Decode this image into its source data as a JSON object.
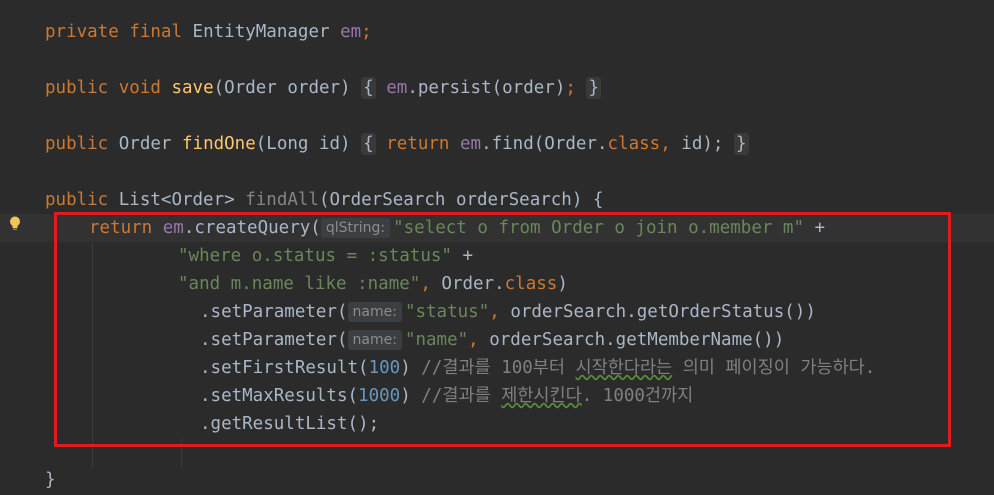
{
  "code": {
    "l1": {
      "kw1": "private",
      "kw2": "final",
      "type": "EntityManager",
      "field": "em",
      "end": ";"
    },
    "l2": {
      "kw1": "public",
      "kw2": "void",
      "name": "save",
      "params": "(Order order)",
      "brace_open": "{",
      "field": "em",
      "call": ".persist(order)",
      "semi": ";",
      "brace_close": "}"
    },
    "l3": {
      "kw1": "public",
      "type": "Order",
      "name": "findOne",
      "params": "(Long id)",
      "brace_open": "{",
      "ret": "return",
      "field": "em",
      "call1": ".find(Order.",
      "kw_class": "class",
      "comma": ",",
      "call2": " id);",
      "brace_close": "}"
    },
    "l4": {
      "kw1": "public",
      "type": "List<Order>",
      "name": "findAll",
      "params": "(OrderSearch orderSearch) {"
    },
    "l5": {
      "ret": "return",
      "field": "em",
      "call": ".createQuery(",
      "hint": "qlString:",
      "str": "\"select o from Order o join o.member m\"",
      "op": " +"
    },
    "l6": {
      "str": "\"where o.status = :status\"",
      "op": " +"
    },
    "l7": {
      "str": "\"and m.name like :name\"",
      "comma": ",",
      "rest": " Order.",
      "kw_class": "class",
      "close": ")"
    },
    "l8": {
      "call": ".setParameter(",
      "hint": "name:",
      "str": "\"status\"",
      "comma": ",",
      "rest": " orderSearch.getOrderStatus())"
    },
    "l9": {
      "call": ".setParameter(",
      "hint": "name:",
      "str": "\"name\"",
      "comma": ",",
      "rest": " orderSearch.getMemberName())"
    },
    "l10": {
      "call": ".setFirstResult(",
      "num": "100",
      "close": ")",
      "comment_a": "//결과를 100부터 ",
      "comment_b": "시작한다라는",
      "comment_c": " 의미 페이징이 가능하다."
    },
    "l11": {
      "call": ".setMaxResults(",
      "num": "1000",
      "close": ")",
      "comment_a": "//결과를 ",
      "comment_b": "제한시킨다",
      "comment_c": ". 1000건까지"
    },
    "l12": {
      "call": ".getResultList();"
    },
    "l13": {
      "close": "}"
    }
  },
  "icons": {
    "gutter": "lightbulb-icon"
  },
  "colors": {
    "highlight_box": "#e01b22",
    "background": "#2b2b2b"
  }
}
